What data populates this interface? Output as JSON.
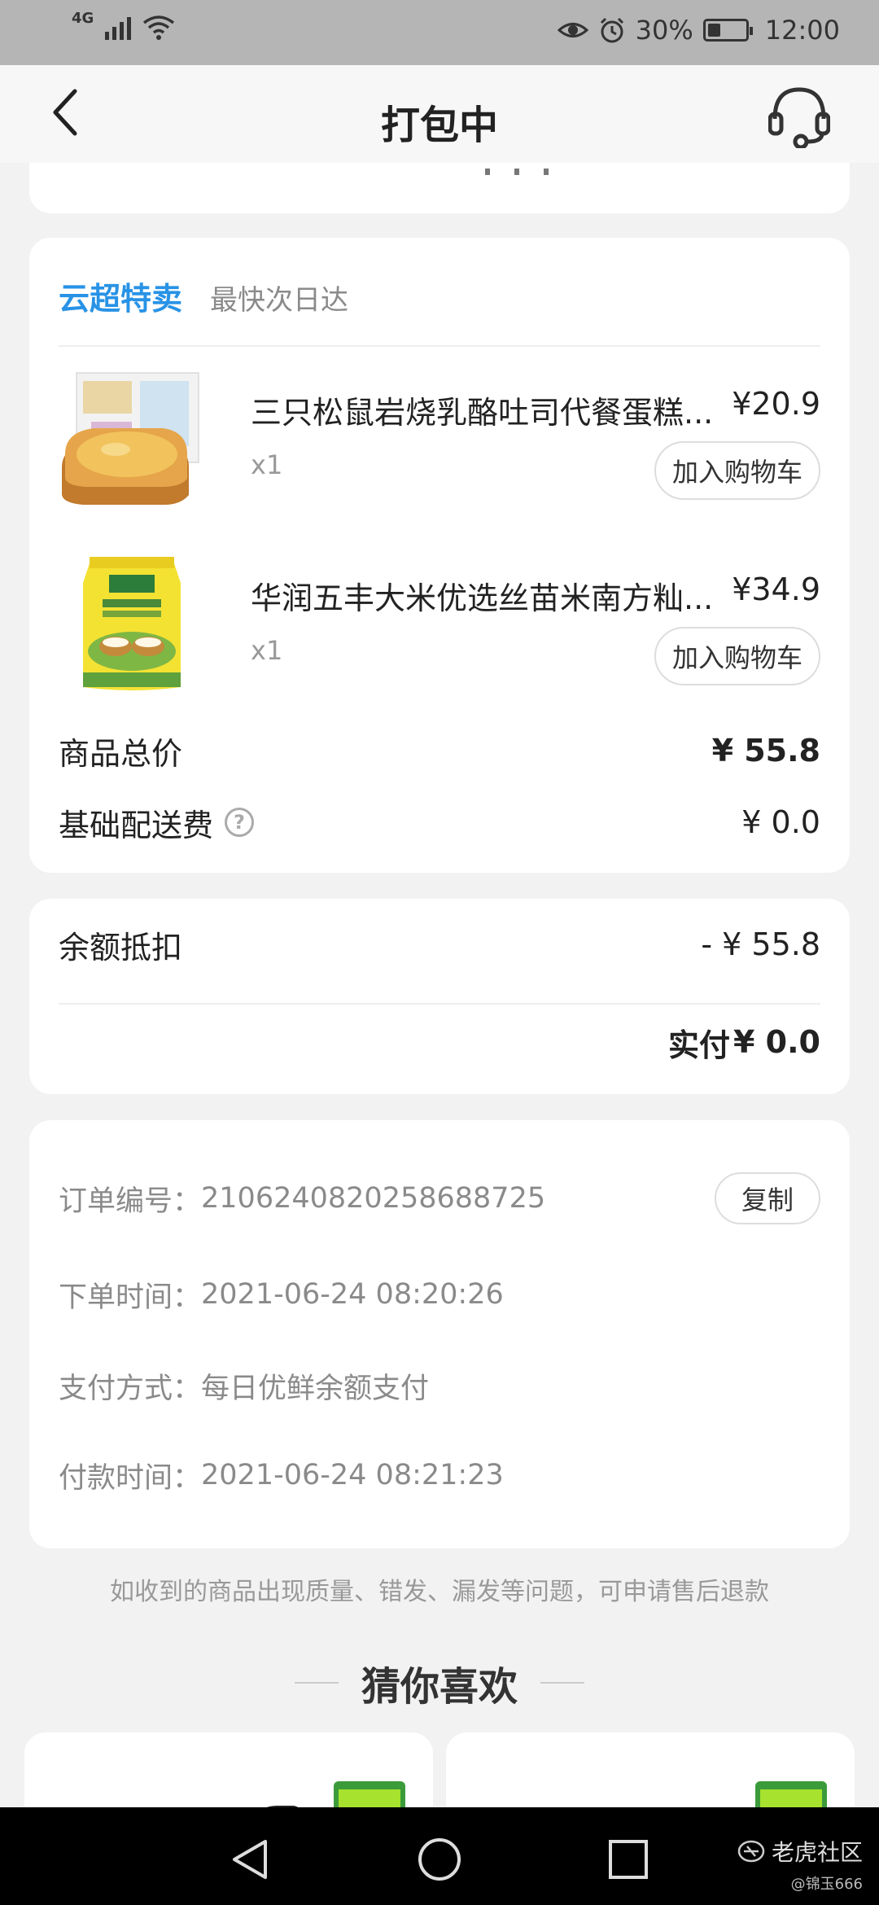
{
  "status_bar": {
    "network": "4G",
    "battery": "30%",
    "time": "12:00"
  },
  "header": {
    "title": "打包中"
  },
  "store": {
    "name": "云超特卖",
    "delivery_tag": "最快次日达"
  },
  "products": [
    {
      "name": "三只松鼠岩烧乳酪吐司代餐蛋糕...",
      "price": "¥20.9",
      "qty": "x1",
      "cart_label": "加入购物车"
    },
    {
      "name": "华润五丰大米优选丝苗米南方籼...",
      "price": "¥34.9",
      "qty": "x1",
      "cart_label": "加入购物车"
    }
  ],
  "summary": {
    "total_label": "商品总价",
    "total_value": "¥ 55.8",
    "delivery_label": "基础配送费",
    "delivery_value": "¥ 0.0"
  },
  "payment": {
    "balance_label": "余额抵扣",
    "balance_value": "- ¥ 55.8",
    "paid_label": "实付",
    "paid_value": "¥ 0.0"
  },
  "order": {
    "number_label": "订单编号：",
    "number_value": "2106240820258688725",
    "copy_label": "复制",
    "time_label": "下单时间：",
    "time_value": "2021-06-24 08:20:26",
    "method_label": "支付方式：",
    "method_value": "每日优鲜余额支付",
    "paytime_label": "付款时间：",
    "paytime_value": "2021-06-24 08:21:23"
  },
  "notice": "如收到的商品出现质量、错发、漏发等问题，可申请售后退款",
  "recommend": {
    "title": "猜你喜欢"
  },
  "watermark": {
    "brand": "老虎社区",
    "user": "@锦玉666"
  },
  "colors": {
    "accent": "#2893e6",
    "background": "#f2f2f2"
  }
}
